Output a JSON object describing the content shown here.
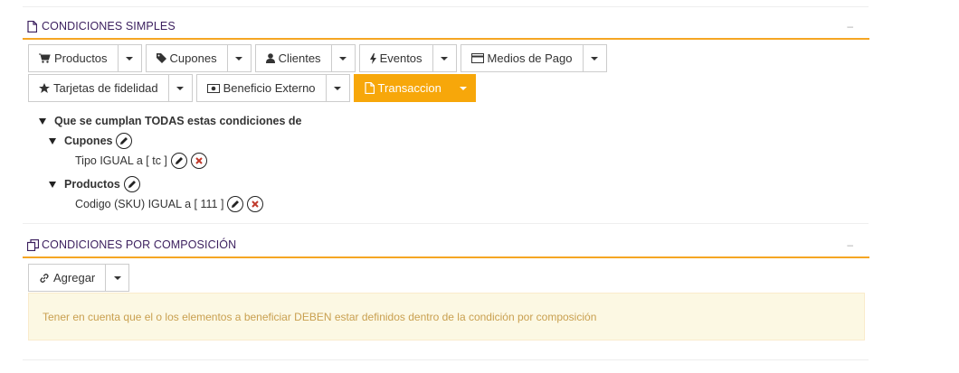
{
  "section_simple": {
    "title": "CONDICIONES SIMPLES",
    "minimize": "–",
    "buttons": [
      {
        "label": "Productos",
        "icon": "cart-icon"
      },
      {
        "label": "Cupones",
        "icon": "tag-icon"
      },
      {
        "label": "Clientes",
        "icon": "user-icon"
      },
      {
        "label": "Eventos",
        "icon": "bolt-icon"
      },
      {
        "label": "Medios de Pago",
        "icon": "credit-card-icon"
      },
      {
        "label": "Tarjetas de fidelidad",
        "icon": "star-icon"
      },
      {
        "label": "Beneficio Externo",
        "icon": "money-icon"
      },
      {
        "label": "Transaccion",
        "icon": "file-icon",
        "active": true
      }
    ],
    "tree": {
      "root": "Que se cumplan TODAS estas condiciones de",
      "groups": [
        {
          "name": "Cupones",
          "condition": "Tipo IGUAL a [ tc ]"
        },
        {
          "name": "Productos",
          "condition": "Codigo (SKU) IGUAL a [ 111 ]"
        }
      ]
    }
  },
  "section_composition": {
    "title": "CONDICIONES POR COMPOSICIÓN",
    "minimize": "–",
    "add_button": "Agregar",
    "alert": "Tener en cuenta que el o los elementos a beneficiar DEBEN estar definidos dentro de la condición por composición"
  },
  "colors": {
    "accent": "#f5a623",
    "active_button": "#f7a70a",
    "title": "#3b1f5e",
    "alert_bg": "#fcf8e3",
    "alert_text": "#c9a050",
    "delete": "#c0392b"
  }
}
